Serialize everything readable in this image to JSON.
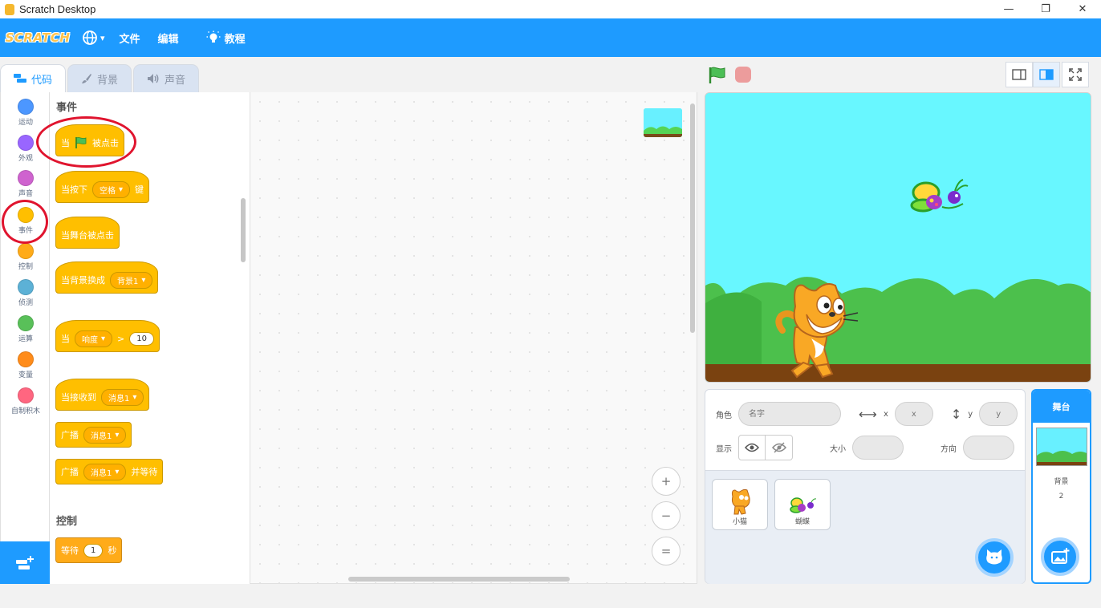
{
  "window": {
    "title": "Scratch Desktop",
    "minimize": "—",
    "maximize": "❐",
    "close": "✕"
  },
  "menubar": {
    "logo": "SCRATCH",
    "globe_arrow": "▾",
    "file": "文件",
    "edit": "编辑",
    "tutorials": "教程"
  },
  "tabs": {
    "code": "代码",
    "backdrops": "背景",
    "sounds": "声音"
  },
  "categories": [
    {
      "label": "运动",
      "color": "#4c97ff"
    },
    {
      "label": "外观",
      "color": "#9966ff"
    },
    {
      "label": "声音",
      "color": "#cf63cf"
    },
    {
      "label": "事件",
      "color": "#ffbf00"
    },
    {
      "label": "控制",
      "color": "#ffab19"
    },
    {
      "label": "侦测",
      "color": "#5cb1d6"
    },
    {
      "label": "运算",
      "color": "#59c059"
    },
    {
      "label": "变量",
      "color": "#ff8c1a"
    },
    {
      "label": "自制积木",
      "color": "#ff6680"
    }
  ],
  "palette": {
    "events_header": "事件",
    "control_header": "控制",
    "blocks": {
      "when_flag_pre": "当",
      "when_flag_post": "被点击",
      "when_key_pre": "当按下",
      "when_key_dd": "空格",
      "when_key_post": "键",
      "when_stage": "当舞台被点击",
      "when_backdrop_pre": "当背景换成",
      "when_backdrop_dd": "背景1",
      "when_loud_pre": "当",
      "when_loud_dd": "响度",
      "when_loud_op": ">",
      "when_loud_value": "10",
      "when_receive_pre": "当接收到",
      "when_receive_dd": "消息1",
      "broadcast_pre": "广播",
      "broadcast_dd": "消息1",
      "broadcast_wait_pre": "广播",
      "broadcast_wait_dd": "消息1",
      "broadcast_wait_post": "并等待",
      "wait_pre": "等待",
      "wait_value": "1",
      "wait_post": "秒"
    }
  },
  "zoom": {
    "in": "+",
    "out": "−",
    "reset": "="
  },
  "sprite_info": {
    "sprite_label": "角色",
    "name_placeholder": "名字",
    "x_label": "x",
    "x_placeholder": "x",
    "y_label": "y",
    "y_placeholder": "y",
    "show_label": "显示",
    "size_label": "大小",
    "direction_label": "方向"
  },
  "sprites": [
    {
      "name": "小猫"
    },
    {
      "name": "蝴蝶"
    }
  ],
  "stage_pane": {
    "header": "舞台",
    "backdrops_label": "背景",
    "backdrop_count": "2"
  },
  "colors": {
    "accent": "#1e9bff",
    "events": "#ffbf00",
    "annotation": "#e0142e"
  }
}
